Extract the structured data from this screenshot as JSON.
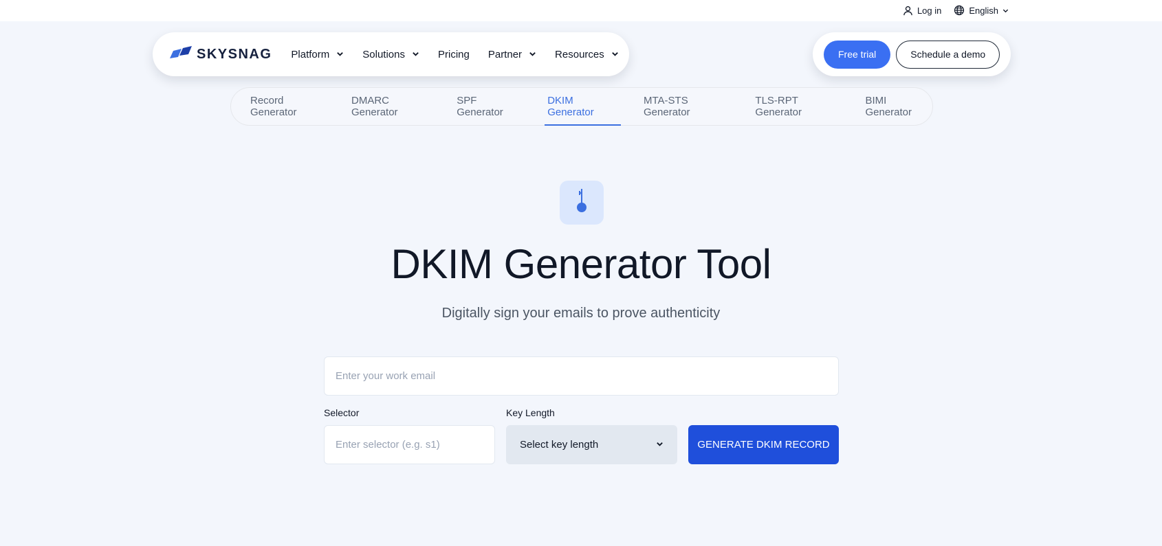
{
  "topbar": {
    "login_label": "Log in",
    "language_label": "English",
    "icons": [
      "user-icon",
      "globe-icon",
      "chevron-down-icon"
    ]
  },
  "nav": {
    "logo_text": "SKYSNAG",
    "items": [
      {
        "label": "Platform",
        "has_dropdown": true
      },
      {
        "label": "Solutions",
        "has_dropdown": true
      },
      {
        "label": "Pricing",
        "has_dropdown": false
      },
      {
        "label": "Partner",
        "has_dropdown": true
      },
      {
        "label": "Resources",
        "has_dropdown": true
      }
    ],
    "free_trial_label": "Free trial",
    "schedule_demo_label": "Schedule a demo"
  },
  "tabs": [
    {
      "label": "Record Generator",
      "active": false
    },
    {
      "label": "DMARC Generator",
      "active": false
    },
    {
      "label": "SPF Generator",
      "active": false
    },
    {
      "label": "DKIM Generator",
      "active": true
    },
    {
      "label": "MTA-STS Generator",
      "active": false
    },
    {
      "label": "TLS-RPT Generator",
      "active": false
    },
    {
      "label": "BIMI Generator",
      "active": false
    }
  ],
  "hero": {
    "icon": "key-icon",
    "title": "DKIM Generator Tool",
    "subtitle": "Digitally sign your emails to prove authenticity"
  },
  "form": {
    "email_placeholder": "Enter your work email",
    "email_value": "",
    "selector_label": "Selector",
    "selector_placeholder": "Enter selector (e.g. s1)",
    "selector_value": "",
    "key_length_label": "Key Length",
    "key_length_selected": "Select key length",
    "generate_label": "GENERATE DKIM RECORD"
  },
  "colors": {
    "accent": "#3a6ff2",
    "generate_button": "#1f4fdb",
    "active_tab": "#3b6fe0",
    "page_background": "#f3f6fc"
  }
}
